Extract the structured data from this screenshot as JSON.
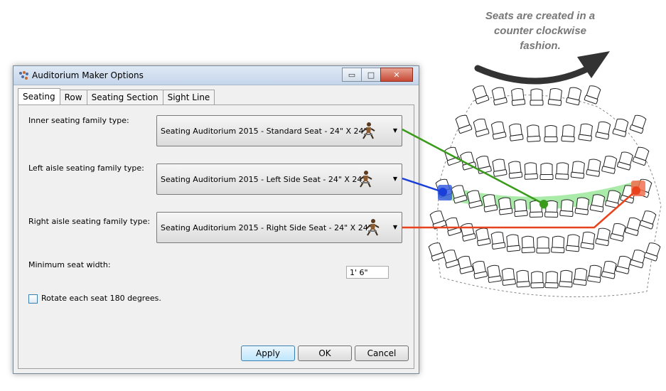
{
  "window": {
    "title": "Auditorium Maker Options",
    "controls": {
      "minimize": "▭",
      "maximize": "□",
      "close": "✕"
    }
  },
  "tabs": [
    {
      "label": "Seating",
      "active": true
    },
    {
      "label": "Row"
    },
    {
      "label": "Seating Section"
    },
    {
      "label": "Sight Line"
    }
  ],
  "seating": {
    "inner_label": "Inner seating family type:",
    "inner_value": "Seating Auditorium 2015 - Standard Seat - 24\" X 24\"",
    "left_label": "Left aisle seating family type:",
    "left_value": "Seating Auditorium 2015 - Left Side Seat - 24\" X 24\"",
    "right_label": "Right aisle seating family type:",
    "right_value": "Seating Auditorium 2015 - Right Side Seat - 24\" X 24\"",
    "min_width_label": "Minimum seat width:",
    "min_width_value": "1'  6\"",
    "rotate_label": "Rotate each seat 180 degrees.",
    "rotate_checked": false
  },
  "buttons": {
    "apply": "Apply",
    "ok": "OK",
    "cancel": "Cancel"
  },
  "annotation": {
    "lines": [
      "Seats are created in a",
      "counter clockwise",
      "fashion."
    ]
  },
  "colors": {
    "inner": "#3a9a1a",
    "left": "#1a3fd9",
    "right": "#e8431c",
    "highlight_row": "#9be89b",
    "arrow": "#333333"
  }
}
